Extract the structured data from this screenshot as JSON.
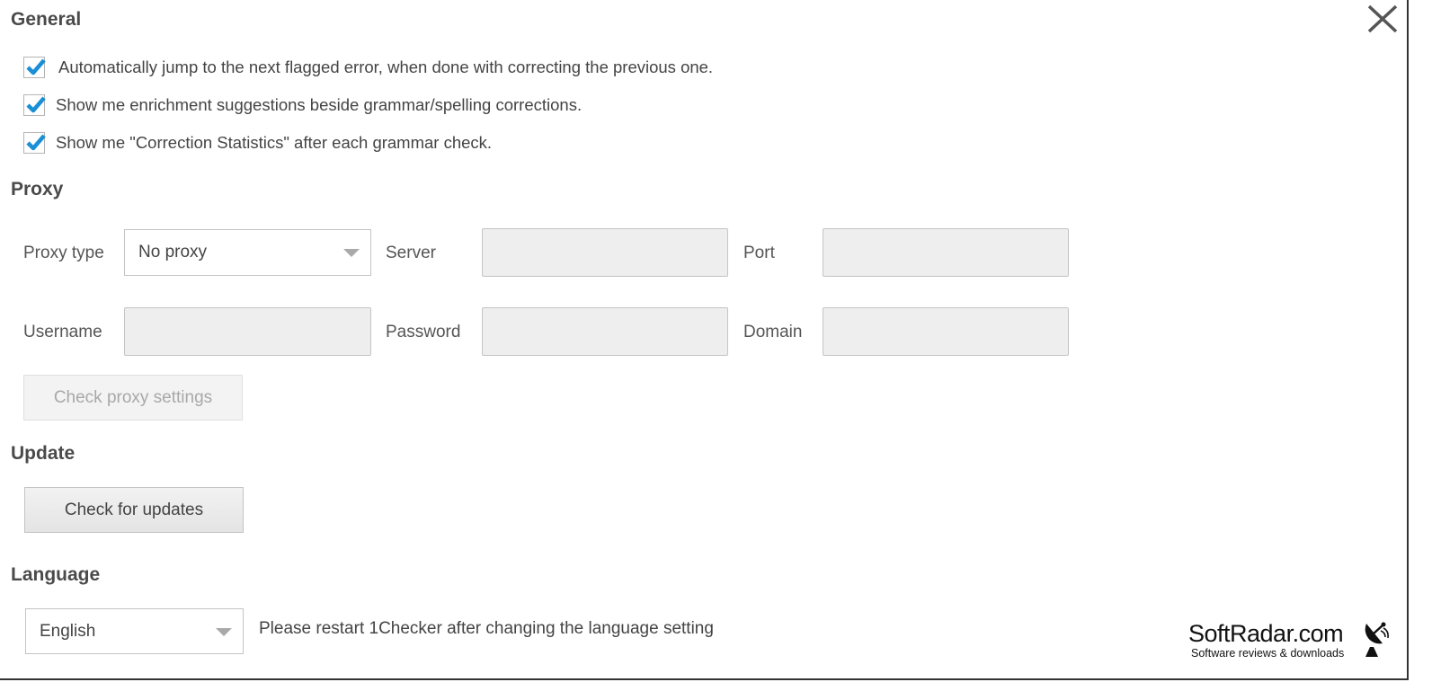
{
  "general": {
    "title": "General",
    "options": [
      {
        "label": "Automatically jump to the next flagged error, when done with correcting the previous one.",
        "checked": true
      },
      {
        "label": "Show me enrichment suggestions beside grammar/spelling corrections.",
        "checked": true
      },
      {
        "label": "Show me \"Correction Statistics\" after each grammar check.",
        "checked": true
      }
    ]
  },
  "proxy": {
    "title": "Proxy",
    "type_label": "Proxy type",
    "type_value": "No proxy",
    "server_label": "Server",
    "port_label": "Port",
    "username_label": "Username",
    "password_label": "Password",
    "domain_label": "Domain",
    "check_button": "Check proxy settings"
  },
  "update": {
    "title": "Update",
    "check_button": "Check for updates"
  },
  "language": {
    "title": "Language",
    "value": "English",
    "hint": "Please restart 1Checker after changing the language setting"
  },
  "watermark": {
    "title": "SoftRadar.com",
    "subtitle": "Software reviews & downloads"
  },
  "colors": {
    "check_accent": "#1a8fd6",
    "field_bg": "#eeeeee"
  },
  "icons": {
    "close": "close-icon",
    "checkmark": "checkmark-icon",
    "dropdown": "chevron-down-icon",
    "satellite": "satellite-dish-icon"
  }
}
